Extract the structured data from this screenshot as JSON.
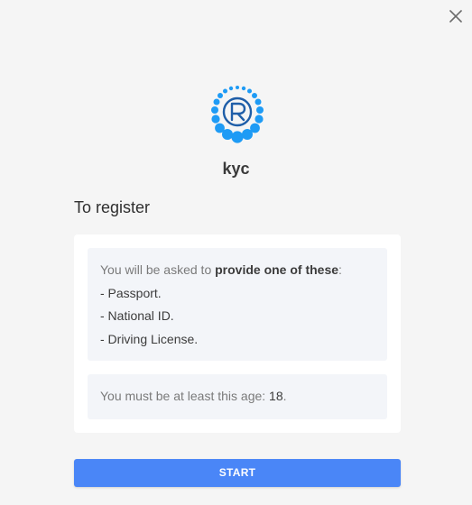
{
  "window": {
    "close_icon": "close-icon"
  },
  "app": {
    "name": "kyc",
    "logo_icon": "kyc-logo-icon",
    "accent_color": "#4a86f7",
    "logo_color": "#1e9bf5"
  },
  "register": {
    "title": "To register",
    "documents": {
      "intro_prefix": "You will be asked to ",
      "intro_strong": "provide one of these",
      "intro_suffix": ":",
      "items": [
        "- Passport.",
        "- National ID.",
        "- Driving License."
      ]
    },
    "age": {
      "prefix": "You must be at least this age: ",
      "value": "18",
      "suffix": "."
    }
  },
  "actions": {
    "start_label": "START"
  }
}
